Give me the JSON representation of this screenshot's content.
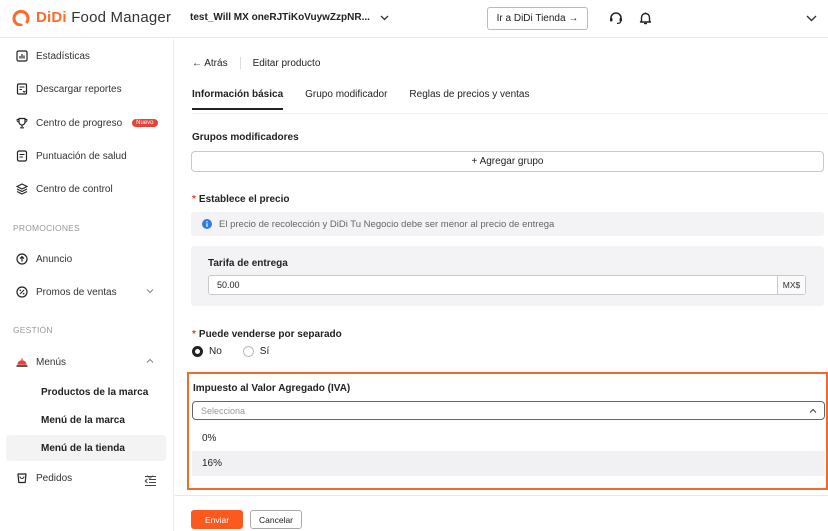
{
  "header": {
    "logo_brand": "DiDi",
    "logo_product": "Food Manager",
    "store_name": "test_Will MX oneRJTiKoVuywZzpNR...",
    "ir_button": "Ir a DiDi Tienda →",
    "colors": {
      "brand": "#ff6a2a",
      "accent": "#fb5a1e"
    }
  },
  "sidebar": {
    "items": [
      {
        "label": "Estadísticas",
        "icon": "stats-icon"
      },
      {
        "label": "Descargar reportes",
        "icon": "download-report-icon"
      },
      {
        "label": "Centro de progreso",
        "icon": "trophy-icon",
        "badge": "Nuevo"
      },
      {
        "label": "Puntuación de salud",
        "icon": "health-score-icon"
      },
      {
        "label": "Centro de control",
        "icon": "layers-icon"
      }
    ],
    "section_promos": "PROMOCIONES",
    "promo_items": [
      {
        "label": "Anuncio",
        "icon": "arrow-circle-icon"
      },
      {
        "label": "Promos de ventas",
        "icon": "percent-icon"
      }
    ],
    "section_gestion": "GESTIÓN",
    "menus": {
      "label": "Menús",
      "icon": "cloche-icon"
    },
    "menu_sub": [
      {
        "label": "Productos de la marca"
      },
      {
        "label": "Menú de la marca"
      },
      {
        "label": "Menú de la tienda"
      }
    ],
    "pedidos": {
      "label": "Pedidos",
      "icon": "orders-icon"
    }
  },
  "main": {
    "back_label": "← Atrás",
    "page_title": "Editar producto",
    "tabs": [
      {
        "label": "Información básica",
        "active": true
      },
      {
        "label": "Grupo modificador",
        "active": false
      },
      {
        "label": "Reglas de precios y ventas",
        "active": false
      }
    ],
    "grupos_label": "Grupos modificadores",
    "add_group": "+ Agregar grupo",
    "precio_label": "Establece el precio",
    "info_text": "El precio de recolección y DiDi Tu Negocio debe ser menor al precio de entrega",
    "tarifa_label": "Tarifa de entrega",
    "tarifa_value": "50.00",
    "tarifa_unit": "MX$",
    "separado_label": "Puede venderse por separado",
    "radio_no": "No",
    "radio_si": "Sí",
    "radio_selected": "No",
    "iva_label": "Impuesto al Valor Agregado (IVA)",
    "iva_placeholder": "Selecciona",
    "iva_options": [
      "0%",
      "16%"
    ]
  },
  "footer": {
    "send": "Enviar",
    "cancel": "Cancelar"
  }
}
